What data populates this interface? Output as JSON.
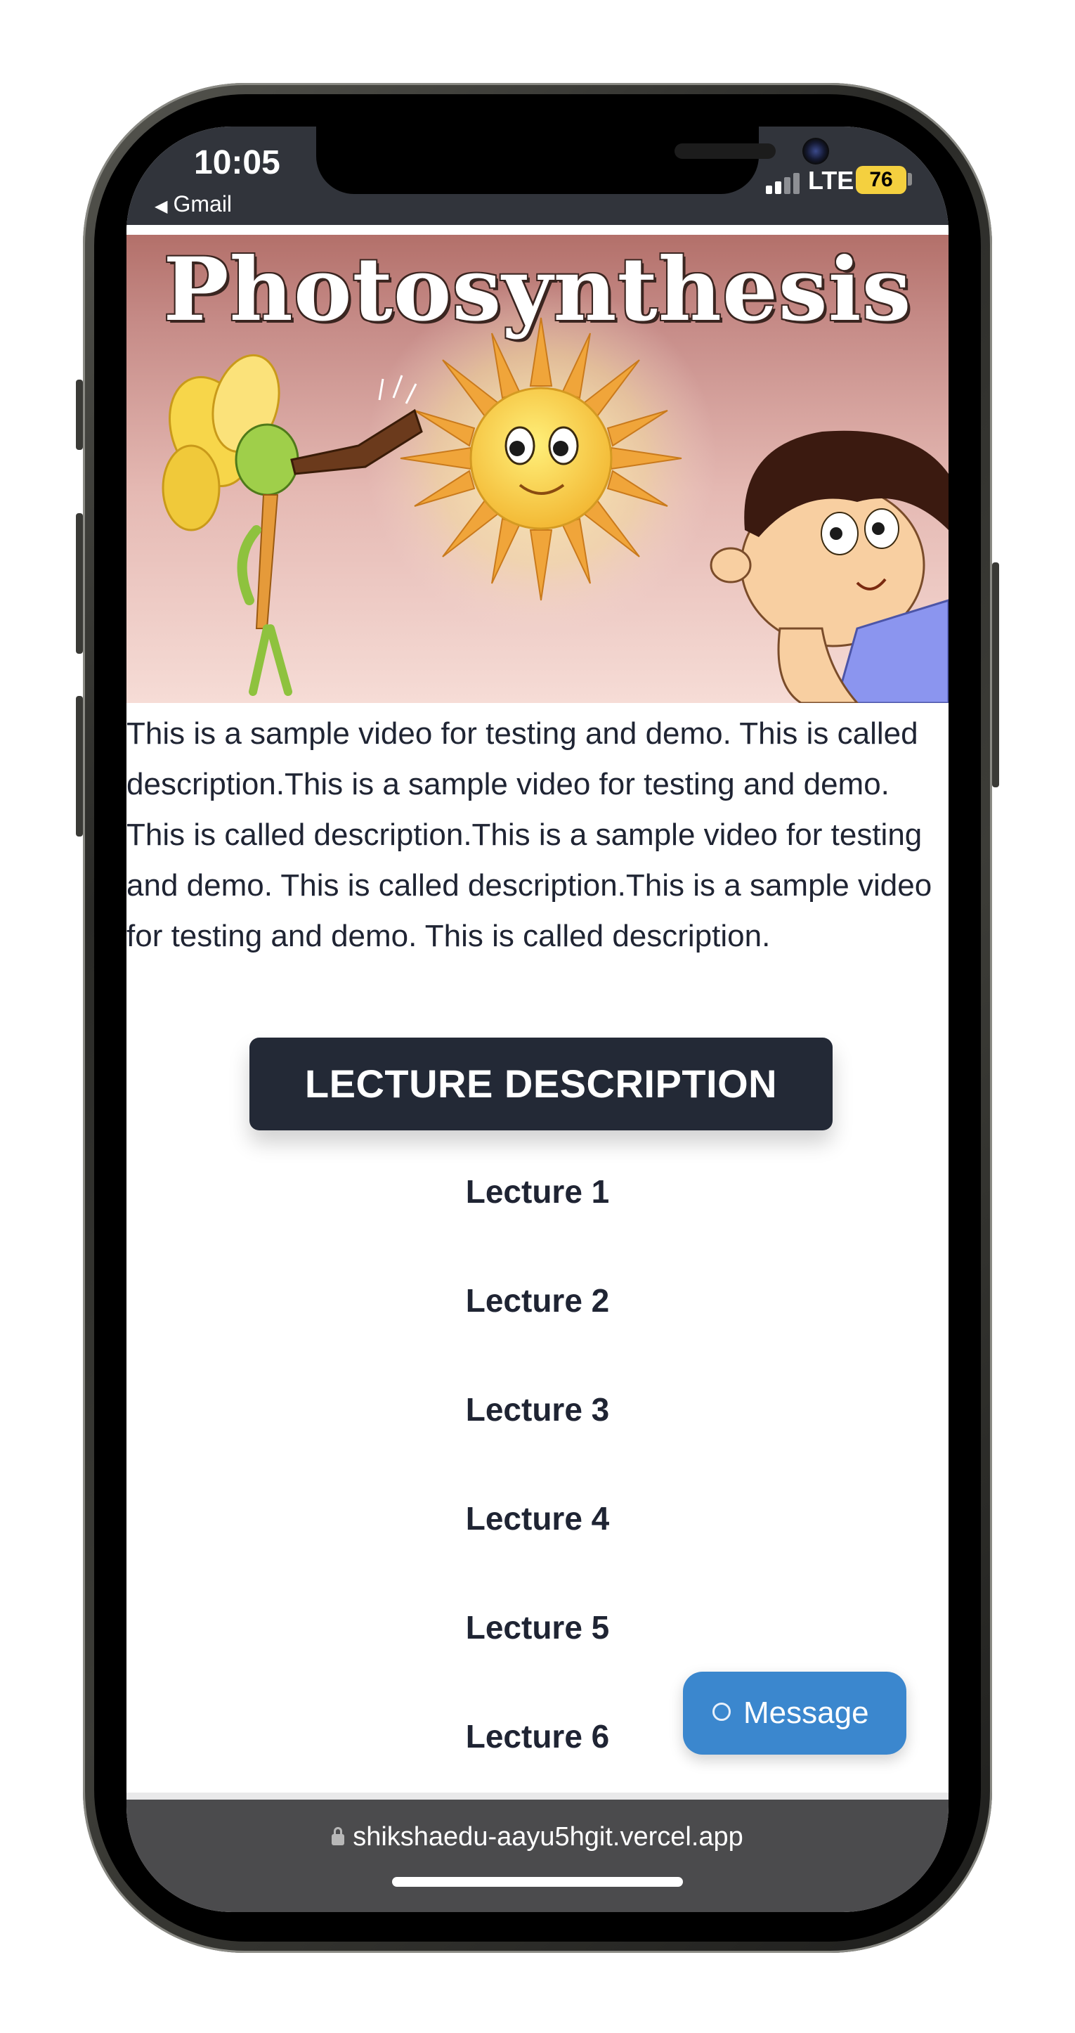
{
  "status_bar": {
    "time": "10:05",
    "back_app": "Gmail",
    "network": "LTE",
    "battery": "76"
  },
  "hero": {
    "title": "Photosynthesis"
  },
  "video": {
    "description": "This is a sample video for testing and demo. This is called description.This is a sample video for testing and demo. This is called description.This is a sample video for testing and demo. This is called description.This is a sample video for testing and demo. This is called description."
  },
  "lecture_description_button": "LECTURE DESCRIPTION",
  "lectures": [
    {
      "label": "Lecture 1"
    },
    {
      "label": "Lecture 2"
    },
    {
      "label": "Lecture 3"
    },
    {
      "label": "Lecture 4"
    },
    {
      "label": "Lecture 5"
    },
    {
      "label": "Lecture 6"
    }
  ],
  "message_button": {
    "label": "Message"
  },
  "browser": {
    "url": "shikshaedu-aayu5hgit.vercel.app"
  },
  "colors": {
    "status_bar_bg": "#31343b",
    "button_dark": "#232936",
    "message_blue": "#3b87ce",
    "battery_yellow": "#f4d03f",
    "url_bar_bg": "#4b4b4d"
  }
}
